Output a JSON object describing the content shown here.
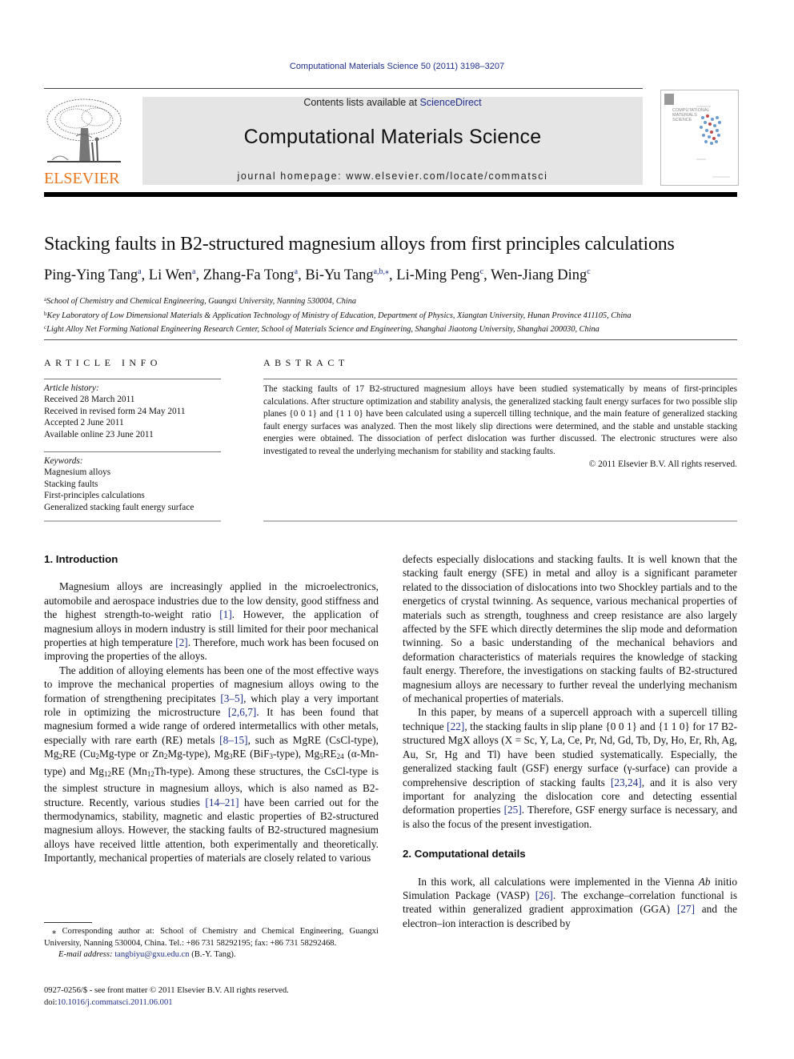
{
  "header": {
    "journal_citation": "Computational Materials Science 50 (2011) 3198–3207",
    "publisher_logo_text": "ELSEVIER",
    "contents_prefix": "Contents lists available at ",
    "contents_link": "ScienceDirect",
    "journal_title": "Computational Materials Science",
    "homepage_prefix": "journal homepage: ",
    "homepage_url": "www.elsevier.com/locate/commatsci",
    "cover_title_lines": [
      "COMPUTATIONAL",
      "MATERIALS",
      "SCIENCE"
    ]
  },
  "article": {
    "title": "Stacking faults in B2-structured magnesium alloys from first principles calculations",
    "authors": [
      {
        "name": "Ping-Ying Tang",
        "aff": "a"
      },
      {
        "name": "Li Wen",
        "aff": "a"
      },
      {
        "name": "Zhang-Fa Tong",
        "aff": "a"
      },
      {
        "name": "Bi-Yu Tang",
        "aff": "a,b,⁎"
      },
      {
        "name": "Li-Ming Peng",
        "aff": "c"
      },
      {
        "name": "Wen-Jiang Ding",
        "aff": "c"
      }
    ],
    "affiliations": [
      {
        "key": "a",
        "text": "School of Chemistry and Chemical Engineering, Guangxi University, Nanning 530004, China"
      },
      {
        "key": "b",
        "text": "Key Laboratory of Low Dimensional Materials & Application Technology of Ministry of Education, Department of Physics, Xiangtan University, Hunan Province 411105, China"
      },
      {
        "key": "c",
        "text": "Light Alloy Net Forming National Engineering Research Center, School of Materials Science and Engineering, Shanghai Jiaotong University, Shanghai 200030, China"
      }
    ]
  },
  "article_info": {
    "heading": "ARTICLE INFO",
    "history_label": "Article history:",
    "history": [
      "Received 28 March 2011",
      "Received in revised form 24 May 2011",
      "Accepted 2 June 2011",
      "Available online 23 June 2011"
    ],
    "keywords_label": "Keywords:",
    "keywords": [
      "Magnesium alloys",
      "Stacking faults",
      "First-principles calculations",
      "Generalized stacking fault energy surface"
    ]
  },
  "abstract": {
    "heading": "ABSTRACT",
    "text": "The stacking faults of 17 B2-structured magnesium alloys have been studied systematically by means of first-principles calculations. After structure optimization and stability analysis, the generalized stacking fault energy surfaces for two possible slip planes {0 0 1} and {1 1 0} have been calculated using a supercell tilling technique, and the main feature of generalized stacking fault energy surfaces was analyzed. Then the most likely slip directions were determined, and the stable and unstable stacking energies were obtained. The dissociation of perfect dislocation was further discussed. The electronic structures were also investigated to reveal the underlying mechanism for stability and stacking faults.",
    "copyright": "© 2011 Elsevier B.V. All rights reserved."
  },
  "body": {
    "sec1_heading": "1. Introduction",
    "p1": {
      "a": "Magnesium alloys are increasingly applied in the microelectronics, automobile and aerospace industries due to the low density, good stiffness and the highest strength-to-weight ratio ",
      "r1": "[1]",
      "b": ". However, the application of magnesium alloys in modern industry is still limited for their poor mechanical properties at high temperature ",
      "r2": "[2]",
      "c": ". Therefore, much work has been focused on improving the properties of the alloys."
    },
    "p2": {
      "a": "The addition of alloying elements has been one of the most effective ways to improve the mechanical properties of magnesium alloys owing to the formation of strengthening precipitates ",
      "r1": "[3–5]",
      "b": ", which play a very important role in optimizing the microstructure ",
      "r2": "[2,6,7]",
      "c": ". It has been found that magnesium formed a wide range of ordered intermetallics with other metals, especially with rare earth (RE) metals ",
      "r3": "[8–15]",
      "d": ", such as MgRE (CsCl-type), Mg",
      "s1": "2",
      "e": "RE (Cu",
      "s2": "2",
      "f": "Mg-type or Zn",
      "s3": "2",
      "g": "Mg-type), Mg",
      "s4": "3",
      "h": "RE (BiF",
      "s5": "3",
      "i": "-type), Mg",
      "s6": "5",
      "j": "RE",
      "s7": "24",
      "k": " (α-Mn-type) and Mg",
      "s8": "12",
      "l": "RE (Mn",
      "s9": "12",
      "m": "Th-type). Among these structures, the CsCl-type is the simplest structure in magnesium alloys, which is also named as B2-structure. Recently, various studies ",
      "r4": "[14–21]",
      "n": " have been carried out for the thermodynamics, stability, magnetic and elastic properties of B2-structured magnesium alloys. However, the stacking faults of B2-structured magnesium alloys have received little attention, both experimentally and theoretically. Importantly, mechanical properties of materials are closely related to various "
    },
    "p2_cont": "defects especially dislocations and stacking faults. It is well known that the stacking fault energy (SFE) in metal and alloy is a significant parameter related to the dissociation of dislocations into two Shockley partials and to the energetics of crystal twinning. As sequence, various mechanical properties of materials such as strength, toughness and creep resistance are also largely affected by the SFE which directly determines the slip mode and deformation twinning. So a basic understanding of the mechanical behaviors and deformation characteristics of materials requires the knowledge of stacking fault energy. Therefore, the investigations on stacking faults of B2-structured magnesium alloys are necessary to further reveal the underlying mechanism of mechanical properties of materials.",
    "p3": {
      "a": "In this paper, by means of a supercell approach with a supercell tilling technique ",
      "r1": "[22]",
      "b": ", the stacking faults in slip plane {0 0 1} and {1 1 0} for 17 B2-structured MgX alloys (X = Sc, Y, La, Ce, Pr, Nd, Gd, Tb, Dy, Ho, Er, Rh, Ag, Au, Sr, Hg and Tl) have been studied systematically. Especially, the generalized stacking fault (GSF) energy surface (γ-surface) can provide a comprehensive description of stacking faults ",
      "r2": "[23,24]",
      "c": ", and it is also very important for analyzing the dislocation core and detecting essential deformation properties ",
      "r3": "[25]",
      "d": ". Therefore, GSF energy surface is necessary, and is also the focus of the present investigation."
    },
    "sec2_heading": "2. Computational details",
    "p4": {
      "a": "In this work, all calculations were implemented in the Vienna ",
      "ab": "Ab",
      "b": " initio Simulation Package (VASP) ",
      "r1": "[26]",
      "c": ". The exchange–correlation functional is treated within generalized gradient approximation (GGA) ",
      "r2": "[27]",
      "d": " and the electron–ion interaction is described by"
    }
  },
  "footnote": {
    "corresponding": "⁎ Corresponding author at: School of Chemistry and Chemical Engineering, Guangxi University, Nanning 530004, China. Tel.: +86 731 58292195; fax: +86 731 58292468.",
    "email_label": "E-mail address: ",
    "email": "tangbiyu@gxu.edu.cn",
    "email_suffix": " (B.-Y. Tang).",
    "issn_line": "0927-0256/$ - see front matter © 2011 Elsevier B.V. All rights reserved.",
    "doi_prefix": "doi:",
    "doi": "10.1016/j.commatsci.2011.06.001"
  },
  "colors": {
    "link": "#1f2f8a",
    "elsevier_orange": "#e8761f",
    "banner_gray": "#e5e5e5"
  }
}
